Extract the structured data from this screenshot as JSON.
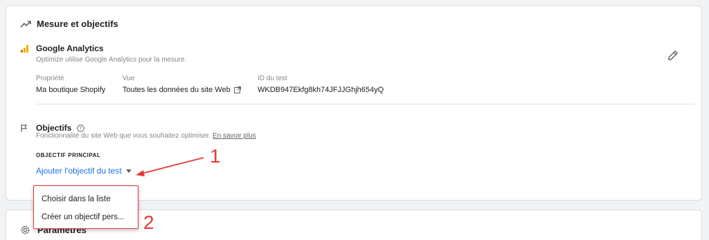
{
  "measure_section": {
    "title": "Mesure et objectifs"
  },
  "analytics": {
    "title": "Google Analytics",
    "description": "Optimize utilise Google Analytics pour la mesure.",
    "property_label": "Propriété",
    "property_value": "Ma boutique Shopify",
    "view_label": "Vue",
    "view_value": "Toutes les données du site Web",
    "test_id_label": "ID du test",
    "test_id_value": "WKDB947Ekfg8kh74JFJJGhjh654yQ"
  },
  "objectives": {
    "title": "Objectifs",
    "description": "Fonctionnalité du site Web que vous souhaitez optimiser.",
    "learn_more": "En savoir plus",
    "principal_label": "OBJECTIF PRINCIPAL",
    "add_goal": "Ajouter l'objectif du test"
  },
  "dropdown": {
    "items": [
      "Choisir dans la liste",
      "Créer un objectif pers..."
    ]
  },
  "annotations": {
    "one": "1",
    "two": "2"
  },
  "params_section": {
    "title": "Paramètres"
  },
  "colors": {
    "accent": "#1a73e8",
    "annotation": "#e53935",
    "analytics_orange": "#f9ab00"
  }
}
